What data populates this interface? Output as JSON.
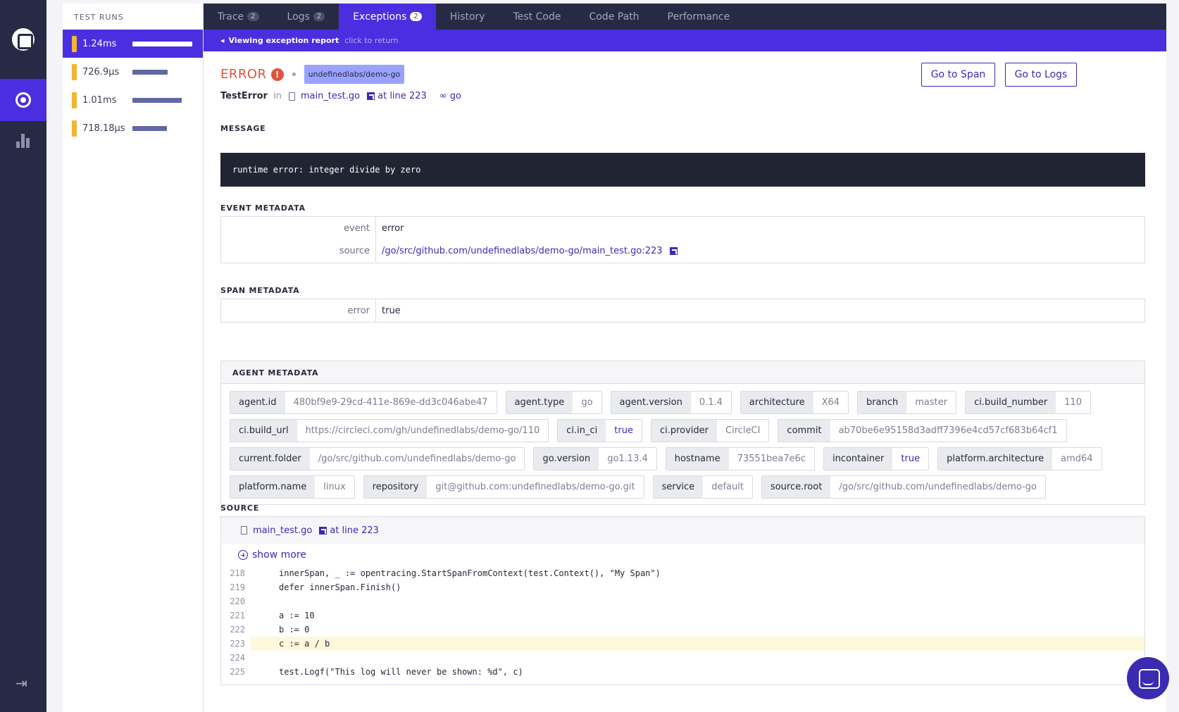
{
  "test_runs": {
    "title": "TEST RUNS",
    "items": [
      {
        "duration": "1.24ms",
        "meter": 0.97
      },
      {
        "duration": "726.9µs",
        "meter": 0.57
      },
      {
        "duration": "1.01ms",
        "meter": 0.79
      },
      {
        "duration": "718.18µs",
        "meter": 0.56
      }
    ]
  },
  "tabs": [
    {
      "label": "Trace",
      "count": "2"
    },
    {
      "label": "Logs",
      "count": "2"
    },
    {
      "label": "Exceptions",
      "count": "2"
    },
    {
      "label": "History"
    },
    {
      "label": "Test Code"
    },
    {
      "label": "Code Path"
    },
    {
      "label": "Performance"
    }
  ],
  "banner": {
    "title": "Viewing exception report",
    "hint": "click to return"
  },
  "exception": {
    "level": "ERROR",
    "repo": "undefinedlabs/demo-go",
    "name": "TestError",
    "in": "in",
    "file": "main_test.go",
    "line_label": "at line",
    "line": "223",
    "language": "go"
  },
  "buttons": {
    "go_to_span": "Go to Span",
    "go_to_logs": "Go to Logs"
  },
  "message": {
    "label": "MESSAGE",
    "text": "runtime error: integer divide by zero"
  },
  "event_metadata": {
    "label": "EVENT METADATA",
    "rows": [
      {
        "key": "event",
        "value": "error"
      },
      {
        "key": "source",
        "value": "/go/src/github.com/undefinedlabs/demo-go/main_test.go:223"
      }
    ]
  },
  "span_metadata": {
    "label": "SPAN METADATA",
    "rows": [
      {
        "key": "error",
        "value": "true"
      }
    ]
  },
  "agent_metadata": {
    "label": "AGENT METADATA",
    "tags": [
      {
        "key": "agent.id",
        "value": "480bf9e9-29cd-411e-869e-dd3c046abe47"
      },
      {
        "key": "agent.type",
        "value": "go"
      },
      {
        "key": "agent.version",
        "value": "0.1.4"
      },
      {
        "key": "architecture",
        "value": "X64"
      },
      {
        "key": "branch",
        "value": "master"
      },
      {
        "key": "ci.build_number",
        "value": "110"
      },
      {
        "key": "ci.build_url",
        "value": "https://circleci.com/gh/undefinedlabs/demo-go/110"
      },
      {
        "key": "ci.in_ci",
        "value": "true"
      },
      {
        "key": "ci.provider",
        "value": "CircleCI"
      },
      {
        "key": "commit",
        "value": "ab70be6e95158d3adff7396e4cd57cf683b64cf1"
      },
      {
        "key": "current.folder",
        "value": "/go/src/github.com/undefinedlabs/demo-go"
      },
      {
        "key": "go.version",
        "value": "go1.13.4"
      },
      {
        "key": "hostname",
        "value": "73551bea7e6c"
      },
      {
        "key": "incontainer",
        "value": "true"
      },
      {
        "key": "platform.architecture",
        "value": "amd64"
      },
      {
        "key": "platform.name",
        "value": "linux"
      },
      {
        "key": "repository",
        "value": "git@github.com:undefinedlabs/demo-go.git"
      },
      {
        "key": "service",
        "value": "default"
      },
      {
        "key": "source.root",
        "value": "/go/src/github.com/undefinedlabs/demo-go"
      }
    ]
  },
  "source": {
    "label": "SOURCE",
    "file": "main_test.go",
    "line_label": "at line",
    "line": "223",
    "show_more": "show more",
    "highlight_line": "223",
    "lines": [
      {
        "n": "218",
        "code": "innerSpan, _ := opentracing.StartSpanFromContext(test.Context(), \"My Span\")"
      },
      {
        "n": "219",
        "code": "defer innerSpan.Finish()"
      },
      {
        "n": "220",
        "code": ""
      },
      {
        "n": "221",
        "code": "a := 10"
      },
      {
        "n": "222",
        "code": "b := 0"
      },
      {
        "n": "223",
        "code": "c := a / b"
      },
      {
        "n": "224",
        "code": ""
      },
      {
        "n": "225",
        "code": "test.Logf(\"This log will never be shown: %d\", c)"
      }
    ]
  },
  "colors": {
    "accent": "#4a2ee0",
    "nav": "#262a44",
    "error": "#e0523e",
    "run_bar": "#f2b632"
  },
  "icons": [
    "app-logo-icon",
    "test-runs-icon",
    "insights-icon",
    "logout-icon",
    "error-icon",
    "file-icon",
    "external-link-icon",
    "go-icon",
    "plus-circle-icon",
    "chat-icon"
  ]
}
